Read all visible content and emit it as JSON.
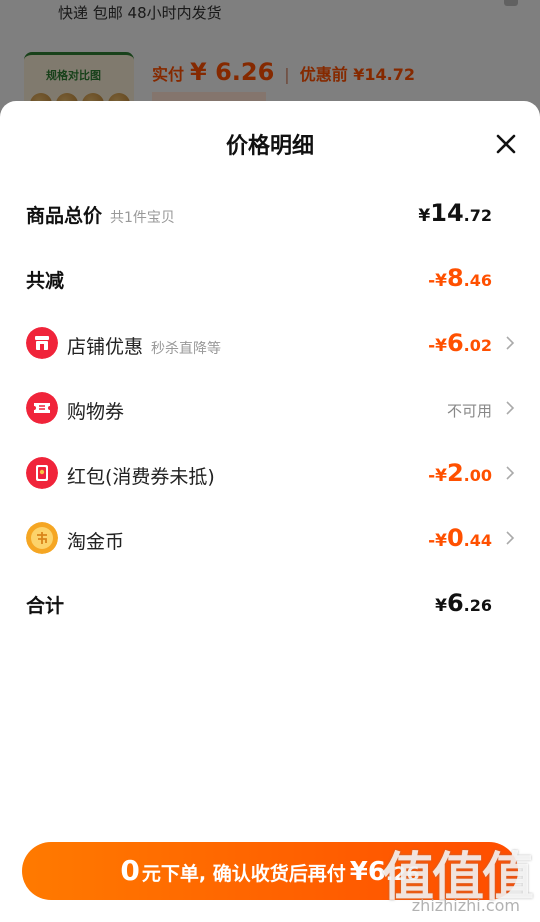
{
  "background": {
    "shipping_text": "快递 包邮 48小时内发货",
    "thumb_label": "规格对比图",
    "paid_label": "实付",
    "paid_amount": "¥ 6.26",
    "original_label": "优惠前 ¥14.72"
  },
  "sheet": {
    "title": "价格明细"
  },
  "rows": {
    "total": {
      "label": "商品总价",
      "sub": "共1件宝贝",
      "sym": "¥",
      "int": "14",
      "dec": ".72"
    },
    "reduced": {
      "label": "共减",
      "sym": "-¥",
      "int": "8",
      "dec": ".46"
    },
    "shop": {
      "label": "店铺优惠",
      "sub": "秒杀直降等",
      "sym": "-¥",
      "int": "6",
      "dec": ".02"
    },
    "coupon": {
      "label": "购物券",
      "status": "不可用"
    },
    "redpacket": {
      "label": "红包(消费券未抵)",
      "sym": "-¥",
      "int": "2",
      "dec": ".00"
    },
    "coins": {
      "label": "淘金币",
      "sym": "-¥",
      "int": "0",
      "dec": ".44"
    },
    "sum": {
      "label": "合计",
      "sym": "¥",
      "int": "6",
      "dec": ".26"
    }
  },
  "cta": {
    "zero": "0",
    "text": "元下单, 确认收货后再付",
    "price": "¥6",
    "price_dec": ".26"
  },
  "watermark": {
    "big": "值值值",
    "small": "zhizhizhi.com"
  },
  "colors": {
    "accent": "#ff5000",
    "icon_red": "#f0243a",
    "icon_gold": "#f5a623"
  }
}
